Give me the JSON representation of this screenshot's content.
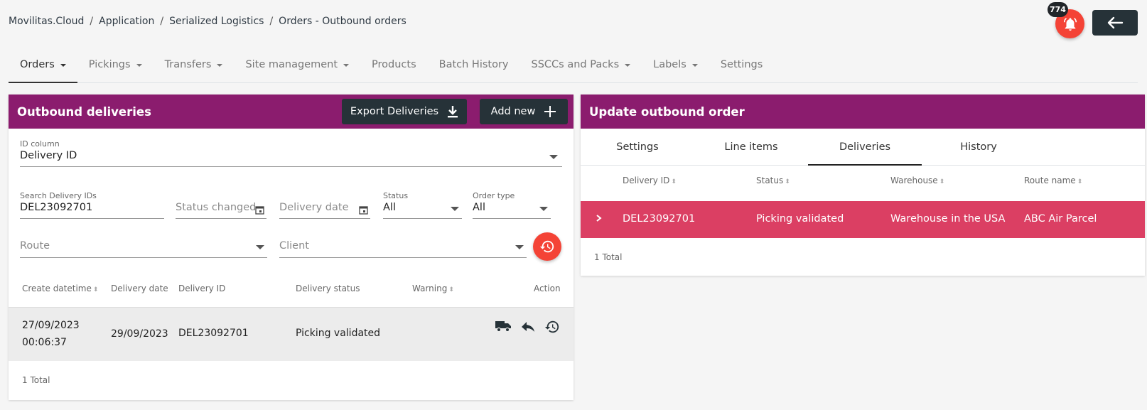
{
  "breadcrumb": {
    "items": [
      "Movilitas.Cloud",
      "Application",
      "Serialized Logistics",
      "Orders - Outbound orders"
    ]
  },
  "header": {
    "notification_count": "774"
  },
  "nav": {
    "tabs": [
      {
        "label": "Orders",
        "dropdown": true,
        "active": true
      },
      {
        "label": "Pickings",
        "dropdown": true
      },
      {
        "label": "Transfers",
        "dropdown": true
      },
      {
        "label": "Site management",
        "dropdown": true
      },
      {
        "label": "Products",
        "dropdown": false
      },
      {
        "label": "Batch History",
        "dropdown": false
      },
      {
        "label": "SSCCs and Packs",
        "dropdown": true
      },
      {
        "label": "Labels",
        "dropdown": true
      },
      {
        "label": "Settings",
        "dropdown": false
      }
    ]
  },
  "left": {
    "title": "Outbound deliveries",
    "export_label": "Export Deliveries",
    "add_label": "Add new",
    "id_column": {
      "label": "ID column",
      "value": "Delivery ID"
    },
    "search": {
      "label": "Search Delivery IDs",
      "value": "DEL23092701"
    },
    "status_changed_placeholder": "Status changed",
    "delivery_date_placeholder": "Delivery date",
    "status": {
      "label": "Status",
      "value": "All"
    },
    "order_type": {
      "label": "Order type",
      "value": "All"
    },
    "route_placeholder": "Route",
    "client_placeholder": "Client",
    "table": {
      "headers": [
        "Create datetime",
        "Delivery date",
        "Delivery ID",
        "Delivery status",
        "Warning",
        "Action"
      ],
      "rows": [
        {
          "create_date": "27/09/2023",
          "create_time": "00:06:37",
          "delivery_date": "29/09/2023",
          "delivery_id": "DEL23092701",
          "delivery_status": "Picking validated",
          "warning": ""
        }
      ]
    },
    "total": "1 Total"
  },
  "right": {
    "title": "Update outbound order",
    "tabs": [
      "Settings",
      "Line items",
      "Deliveries",
      "History"
    ],
    "active_tab": "Deliveries",
    "table": {
      "headers": [
        "Delivery ID",
        "Status",
        "Warehouse",
        "Route name"
      ],
      "rows": [
        {
          "delivery_id": "DEL23092701",
          "status": "Picking validated",
          "warehouse": "Warehouse in the USA",
          "route": "ABC Air Parcel"
        }
      ]
    },
    "total": "1 Total"
  },
  "colors": {
    "header_bg": "#8b1c6e",
    "dark_button": "#263238",
    "danger": "#f44336",
    "row_highlight": "#db3f63"
  }
}
